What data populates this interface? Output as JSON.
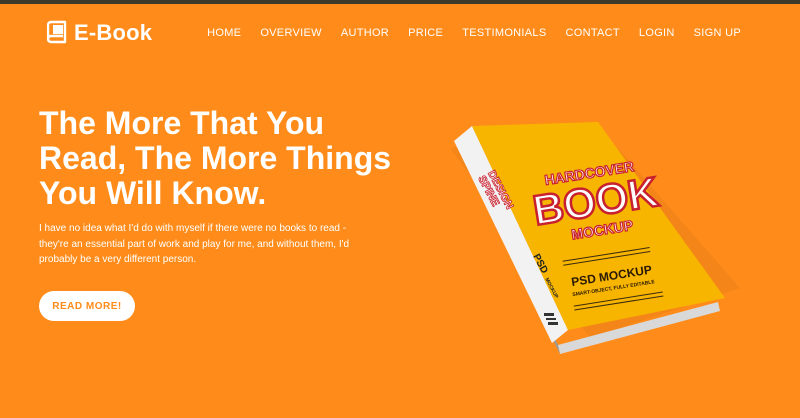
{
  "brand": {
    "logo_text": "E-Book",
    "logo_icon": "book-icon",
    "accent": "#ff8c1a",
    "topbar_color": "#3d3a2c"
  },
  "nav": {
    "items": [
      "HOME",
      "OVERVIEW",
      "AUTHOR",
      "PRICE",
      "TESTIMONIALS",
      "CONTACT",
      "LOGIN",
      "SIGN UP"
    ]
  },
  "hero": {
    "title_line1": "The More That You",
    "title_line2": "Read, The More Things",
    "title_line3": "You Will Know.",
    "text_line1": "I have no idea what I'd do with myself if there were no books to read -",
    "text_line2": "they're an essential part of work and play for me, and without them, I'd",
    "text_line3": "probably be a very different person.",
    "button_label": "READ MORE!"
  },
  "book_cover": {
    "line1": "HARDCOVER",
    "line2": "BOOK",
    "line3": "MOCKUP",
    "psd_label": "PSD MOCKUP",
    "psd_sub": "SMART-OBJECT, FULLY EDITABLE",
    "spine_line1": "SPINE",
    "spine_line2": "DESIGN",
    "spine_psd": "PSD",
    "spine_mockup": "MOCKUP",
    "cover_color": "#f7b500",
    "title_color": "#c8202f"
  }
}
